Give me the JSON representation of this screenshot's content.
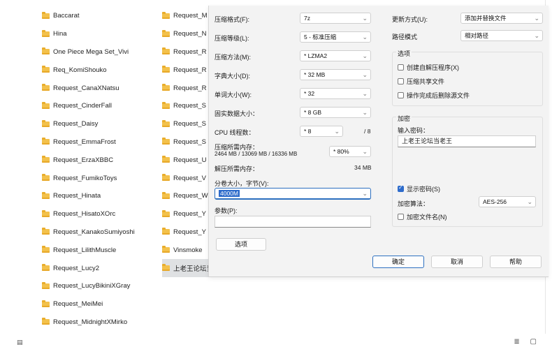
{
  "explorer": {
    "column1": [
      "Baccarat",
      "Hina",
      "One Piece Mega Set_Vivi",
      "Req_KomiShouko",
      "Request_CanaXNatsu",
      "Request_CinderFall",
      "Request_Daisy",
      "Request_EmmaFrost",
      "Request_ErzaXBBC",
      "Request_FumikoToys",
      "Request_Hinata",
      "Request_HisatoXOrc",
      "Request_KanakoSumiyoshi",
      "Request_LilithMuscle",
      "Request_Lucy2",
      "Request_LucyBikiniXGray",
      "Request_MeiMei",
      "Request_MidnightXMirko"
    ],
    "column2": [
      "Request_M",
      "Request_N",
      "Request_R",
      "Request_R",
      "Request_R",
      "Request_S",
      "Request_S",
      "Request_S",
      "Request_U",
      "Request_V",
      "Request_W",
      "Request_Y",
      "Request_Y",
      "Vinsmoke",
      "上老王论坛当老王"
    ],
    "selected_index_col2": 14,
    "statusbar": {
      "left_icon": "details-icon",
      "right_icons": "≣ ▢"
    }
  },
  "dialog": {
    "left": {
      "format_label": "压缩格式(F):",
      "format_value": "7z",
      "level_label": "压缩等级(L):",
      "level_value": "5 - 标准压缩",
      "method_label": "压缩方法(M):",
      "method_value": "* LZMA2",
      "dict_label": "字典大小(D):",
      "dict_value": "* 32 MB",
      "word_label": "单词大小(W):",
      "word_value": "* 32",
      "solid_label": "固实数据大小：",
      "solid_value": "* 8 GB",
      "cpu_label": "CPU 线程数：",
      "cpu_value": "* 8",
      "cpu_total": "/ 8",
      "mem_comp_label": "压缩所需内存：",
      "mem_comp_detail": "2464 MB / 13069 MB / 16336 MB",
      "mem_comp_percent": "* 80%",
      "mem_decomp_label": "解压所需内存：",
      "mem_decomp_value": "34 MB",
      "volume_label": "分卷大小，字节(V):",
      "volume_value": "4000M",
      "params_label": "参数(P):",
      "params_value": "",
      "options_button": "选项"
    },
    "right": {
      "update_label": "更新方式(U):",
      "update_value": "添加并替换文件",
      "path_label": "路径模式",
      "path_value": "相对路径",
      "options_group": "选项",
      "opt_sfx": "创建自解压程序(X)",
      "opt_shared": "压缩共享文件",
      "opt_delete": "操作完成后删除源文件",
      "encrypt_group": "加密",
      "password_label": "输入密码：",
      "password_value": "上老王论坛当老王",
      "show_password": "显示密码(S)",
      "enc_method_label": "加密算法：",
      "enc_method_value": "AES-256",
      "enc_names": "加密文件名(N)"
    },
    "buttons": {
      "ok": "确定",
      "cancel": "取消",
      "help": "帮助"
    },
    "checks": {
      "opt_sfx": false,
      "opt_shared": false,
      "opt_delete": false,
      "show_password": true,
      "enc_names": false
    },
    "accent_color": "#2e6ccb"
  }
}
